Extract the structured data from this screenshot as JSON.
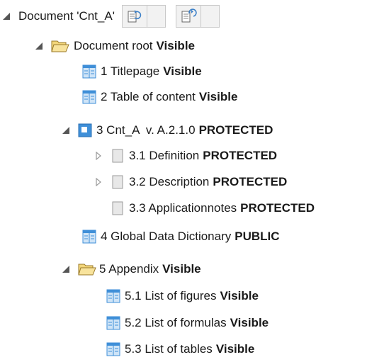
{
  "tree": {
    "root": {
      "label": "Document 'Cnt_A'"
    },
    "toolbar": {
      "icons": [
        "refresh-doc-icon",
        "refresh-doc-alt-icon"
      ]
    },
    "nodes": [
      {
        "id": "docroot",
        "label": "Document root",
        "status": "Visible",
        "icon": "folder-icon",
        "expanded": true
      },
      {
        "id": "n1",
        "label": "1 Titlepage",
        "status": "Visible",
        "icon": "page-visible-icon"
      },
      {
        "id": "n2",
        "label": "2 Table of content",
        "status": "Visible",
        "icon": "page-visible-icon"
      },
      {
        "id": "n3",
        "label": "3 Cnt_A  v. A.2.1.0",
        "status": "PROTECTED",
        "icon": "page-protected-icon",
        "expanded": true
      },
      {
        "id": "n31",
        "label": "3.1 Definition",
        "status": "PROTECTED",
        "icon": "page-blank-icon",
        "collapsed": true
      },
      {
        "id": "n32",
        "label": "3.2 Description",
        "status": "PROTECTED",
        "icon": "page-blank-icon",
        "collapsed": true
      },
      {
        "id": "n33",
        "label": "3.3 Applicationnotes",
        "status": "PROTECTED",
        "icon": "page-blank-icon"
      },
      {
        "id": "n4",
        "label": "4 Global Data Dictionary",
        "status": "PUBLIC",
        "icon": "page-visible-icon"
      },
      {
        "id": "n5",
        "label": "5 Appendix",
        "status": "Visible",
        "icon": "folder-icon",
        "expanded": true
      },
      {
        "id": "n51",
        "label": "5.1 List of figures",
        "status": "Visible",
        "icon": "page-visible-icon"
      },
      {
        "id": "n52",
        "label": "5.2 List of formulas",
        "status": "Visible",
        "icon": "page-visible-icon"
      },
      {
        "id": "n53",
        "label": "5.3 List of tables",
        "status": "Visible",
        "icon": "page-visible-icon"
      }
    ]
  },
  "colors": {
    "caret": "#555555",
    "folder_fill": "#f3d67a",
    "folder_stroke": "#9a7a2a",
    "page_blue": "#3f8fd8",
    "page_blue_light": "#cfe4f7",
    "blank_fill": "#e8e8e8",
    "blank_stroke": "#9a9a9a"
  }
}
